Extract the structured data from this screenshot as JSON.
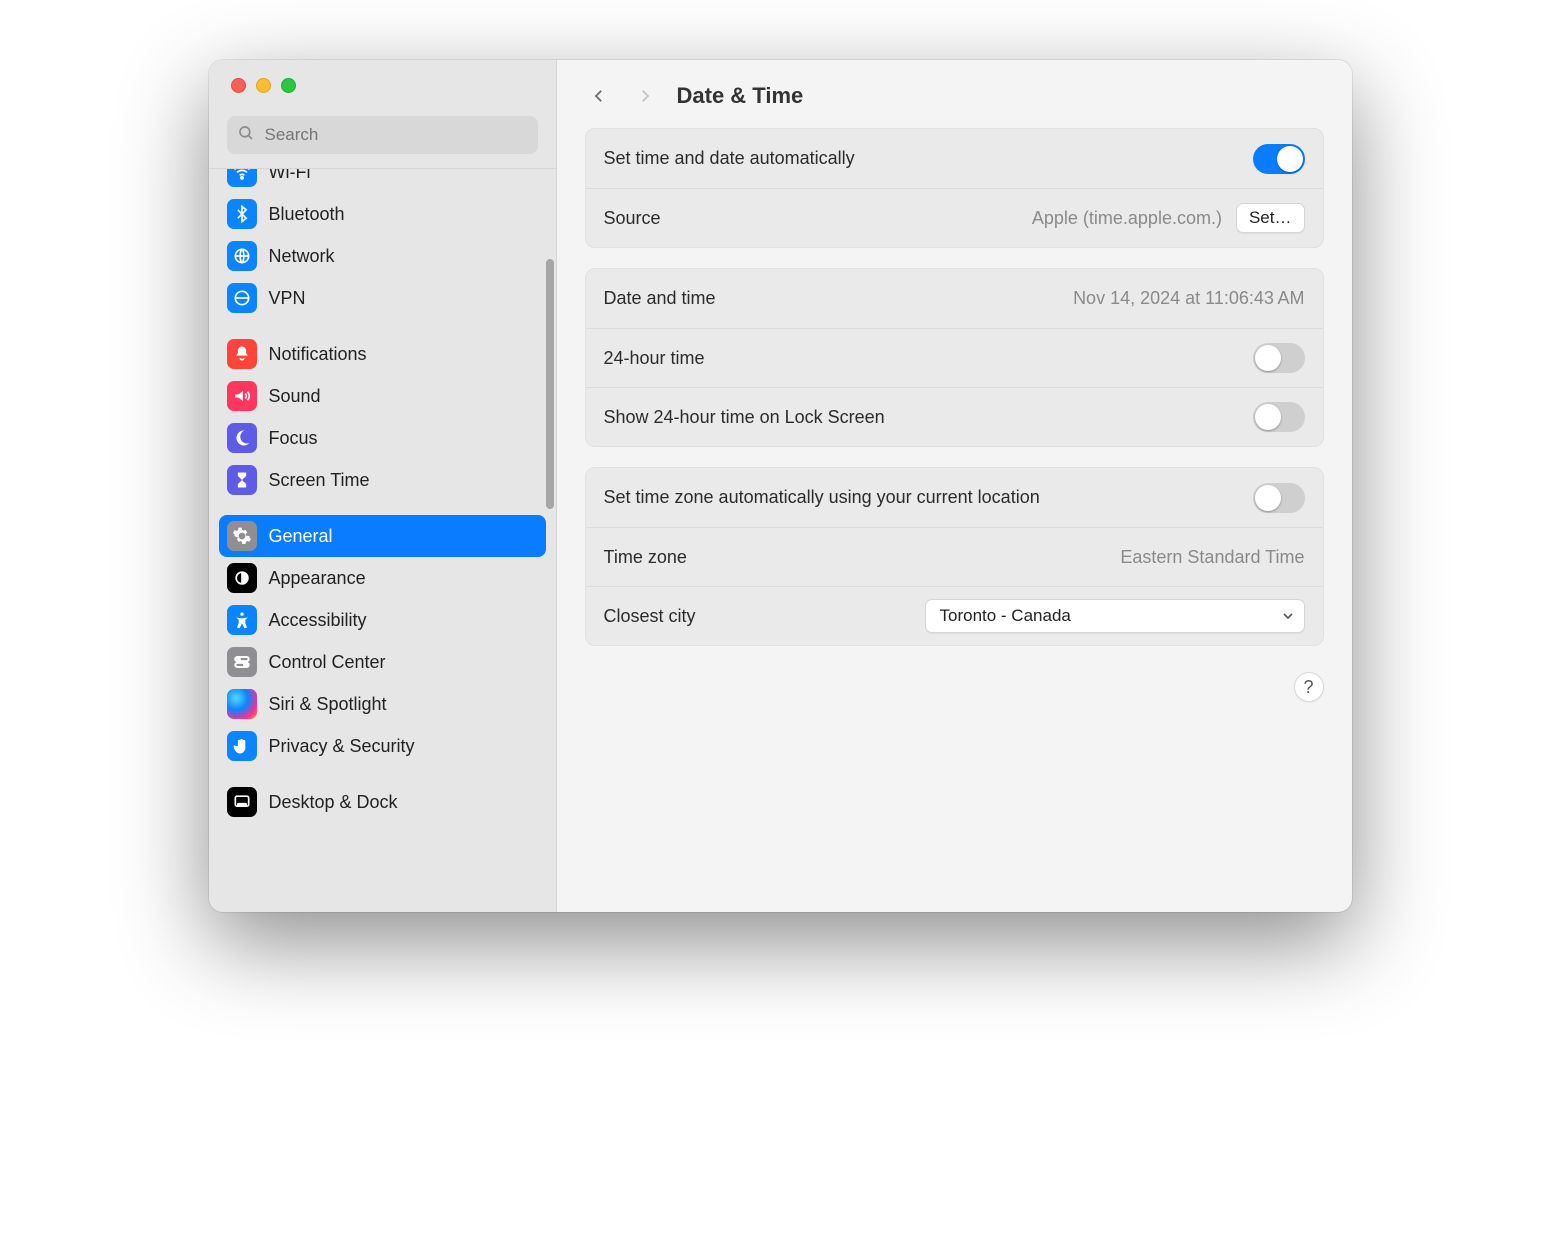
{
  "window": {
    "search_placeholder": "Search",
    "title": "Date & Time"
  },
  "sidebar": {
    "groups": [
      {
        "items": [
          "Wi-Fi",
          "Bluetooth",
          "Network",
          "VPN"
        ]
      },
      {
        "items": [
          "Notifications",
          "Sound",
          "Focus",
          "Screen Time"
        ]
      },
      {
        "items": [
          "General",
          "Appearance",
          "Accessibility",
          "Control Center",
          "Siri & Spotlight",
          "Privacy & Security"
        ]
      },
      {
        "items": [
          "Desktop & Dock"
        ]
      }
    ],
    "selected": "General"
  },
  "section1": {
    "row0": {
      "label": "Set time and date automatically",
      "on": true
    },
    "row1": {
      "label": "Source",
      "value": "Apple (time.apple.com.)",
      "button": "Set…"
    }
  },
  "section2": {
    "row0": {
      "label": "Date and time",
      "value": "Nov 14, 2024 at 11:06:43 AM"
    },
    "row1": {
      "label": "24-hour time",
      "on": false
    },
    "row2": {
      "label": "Show 24-hour time on Lock Screen",
      "on": false
    }
  },
  "section3": {
    "row0": {
      "label": "Set time zone automatically using your current location",
      "on": false
    },
    "row1": {
      "label": "Time zone",
      "value": "Eastern Standard Time"
    },
    "row2": {
      "label": "Closest city",
      "selected": "Toronto - Canada"
    }
  },
  "help": "?"
}
